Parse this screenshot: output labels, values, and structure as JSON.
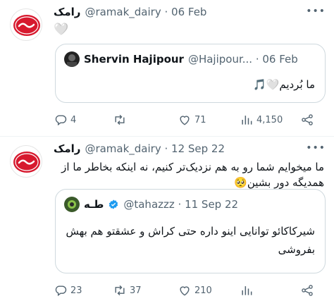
{
  "tweets": [
    {
      "author_name": "رامک",
      "handle": "@ramak_dairy",
      "date": "06 Feb",
      "text": "🤍",
      "quote": {
        "author_name": "Shervin Hajipour",
        "handle": "@Hajipour...",
        "date": "06 Feb",
        "text": "ما بُردیم🤍🎵"
      },
      "stats": {
        "replies": "4",
        "retweets": "",
        "likes": "71",
        "views": "4,150"
      }
    },
    {
      "author_name": "رامک",
      "handle": "@ramak_dairy",
      "date": "12 Sep 22",
      "text": "ما میخوایم شما رو به هم نزدیک‌تر کنیم، نه اینکه بخاطر ما از همدیگه دور بشین🥺",
      "quote": {
        "author_name": "طـه",
        "handle": "@tahazzz",
        "date": "11 Sep 22",
        "text": "شیرکاکائو توانایی اینو داره حتی کراش و عشقتو هم بهش بفروشی"
      },
      "stats": {
        "replies": "23",
        "retweets": "37",
        "likes": "210",
        "views": ""
      }
    }
  ],
  "colors": {
    "brand_red": "#d7192e",
    "muted": "#536471",
    "border": "#cfd9de",
    "verified": "#1d9bf0"
  }
}
